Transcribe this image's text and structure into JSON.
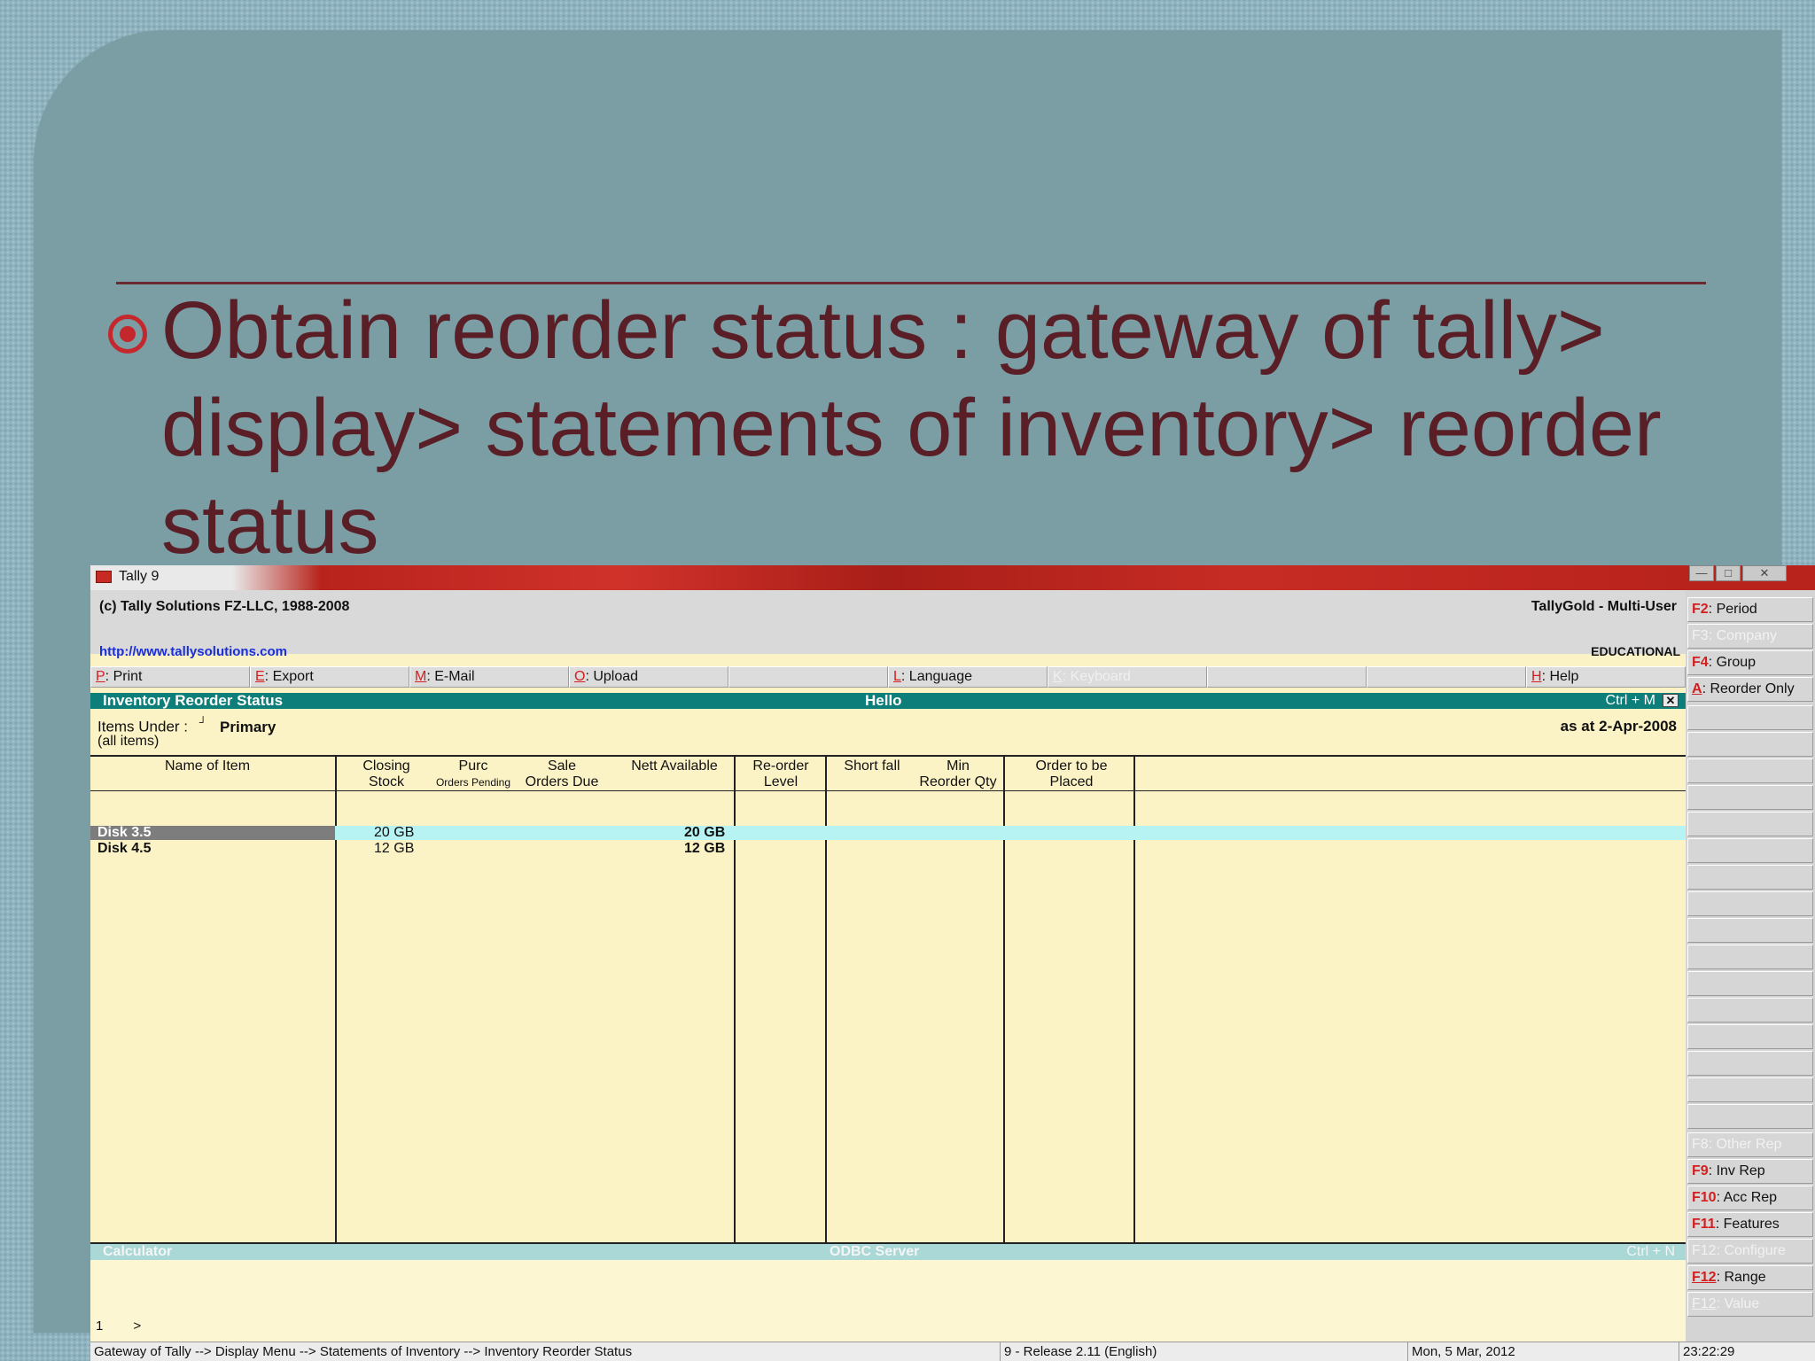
{
  "slide": {
    "heading": "Obtain reorder status : gateway of tally> display> statements of inventory> reorder status",
    "accent_color": "#c4282d",
    "text_color": "#5a1f26"
  },
  "window": {
    "title": "Tally 9",
    "controls": [
      "—",
      "□",
      "✕"
    ]
  },
  "header": {
    "copyright": "(c) Tally Solutions FZ-LLC, 1988-2008",
    "edition": "TallyGold - Multi-User",
    "url": "http://www.tallysolutions.com",
    "license": "EDUCATIONAL"
  },
  "buttons": [
    {
      "key": "P",
      "label": ": Print"
    },
    {
      "key": "E",
      "label": ": Export"
    },
    {
      "key": "M",
      "label": ": E-Mail"
    },
    {
      "key": "O",
      "label": ": Upload"
    },
    {
      "key": "",
      "label": ""
    },
    {
      "key": "L",
      "label": ": Language"
    },
    {
      "key": "K",
      "label": ": Keyboard"
    },
    {
      "key": "",
      "label": ""
    },
    {
      "key": "",
      "label": ""
    },
    {
      "key": "H",
      "label": ": Help"
    }
  ],
  "report": {
    "title": "Inventory Reorder Status",
    "center": "Hello",
    "shortcut": "Ctrl + M",
    "close": "✕",
    "items_under_label": "Items Under :",
    "items_under_marker": "┘",
    "items_under_value": "Primary",
    "all_items": "(all items)",
    "as_at": "as at 2-Apr-2008"
  },
  "table": {
    "headers": {
      "name": "Name of Item",
      "closing_1": "Closing",
      "closing_2": "Stock",
      "purc_1": "Purc",
      "purc_2": "Orders Pending",
      "sale_1": "Sale",
      "sale_2": "Orders Due",
      "nett": "Nett Available",
      "reorder_1": "Re-order",
      "reorder_2": "Level",
      "shortfall": "Short fall",
      "min_1": "Min",
      "min_2": "Reorder Qty",
      "order_1": "Order to be",
      "order_2": "Placed"
    },
    "rows": [
      {
        "name": "Disk 3.5",
        "closing": "20 GB",
        "nett": "20 GB"
      },
      {
        "name": "Disk 4.5",
        "closing": "12 GB",
        "nett": "12 GB"
      }
    ]
  },
  "calc": {
    "left": "Calculator",
    "center": "ODBC Server",
    "right": "Ctrl + N",
    "line_num": "1",
    "prompt": ">"
  },
  "status": {
    "path": "Gateway of Tally --> Display Menu --> Statements of Inventory --> Inventory Reorder Status",
    "release": "9 - Release 2.11 (English)",
    "date": "Mon, 5 Mar, 2012",
    "time": "23:22:29"
  },
  "sidebar": {
    "top": [
      {
        "key": "F2",
        "label": ": Period"
      },
      {
        "key": "F3",
        "label": ": Company"
      },
      {
        "key": "F4",
        "label": ": Group"
      },
      {
        "key": "A",
        "label": ": Reorder Only"
      }
    ],
    "bottom": [
      {
        "key": "F8",
        "label": ": Other Rep"
      },
      {
        "key": "F9",
        "label": ": Inv Rep"
      },
      {
        "key": "F10",
        "label": ": Acc Rep"
      },
      {
        "key": "F11",
        "label": ": Features"
      },
      {
        "key": "F12",
        "label": ": Configure"
      },
      {
        "key": "F12",
        "label": ": Range"
      },
      {
        "key": "F12",
        "label": ": Value"
      }
    ]
  }
}
